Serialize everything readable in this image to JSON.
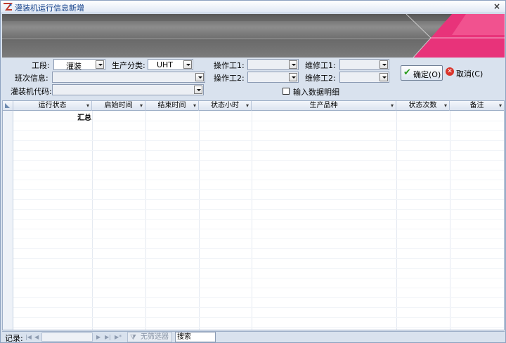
{
  "window": {
    "title": "灌装机运行信息新增",
    "close_label": "×"
  },
  "form": {
    "section_label": "工段:",
    "section_value": "灌装",
    "category_label": "生产分类:",
    "category_value": "UHT",
    "operator1_label": "操作工1:",
    "operator1_value": "",
    "repairer1_label": "维修工1:",
    "repairer1_value": "",
    "shift_label": "班次信息:",
    "shift_value": "",
    "operator2_label": "操作工2:",
    "operator2_value": "",
    "repairer2_label": "维修工2:",
    "repairer2_value": "",
    "filler_code_label": "灌装机代码:",
    "filler_code_value": "",
    "detail_checkbox_label": "输入数据明细",
    "detail_checked": false
  },
  "buttons": {
    "ok_label": "确定(O)",
    "cancel_label": "取消(C)"
  },
  "grid": {
    "columns": [
      "运行状态",
      "启始时间",
      "结束时间",
      "状态小时",
      "生产品种",
      "状态次数",
      "备注"
    ],
    "summary_label": "汇总"
  },
  "statusbar": {
    "record_label": "记录:",
    "filter_label": "无筛选器",
    "search_label": "搜索"
  },
  "colors": {
    "accent_pink": "#e8337a",
    "window_bg": "#d9e2ee"
  }
}
